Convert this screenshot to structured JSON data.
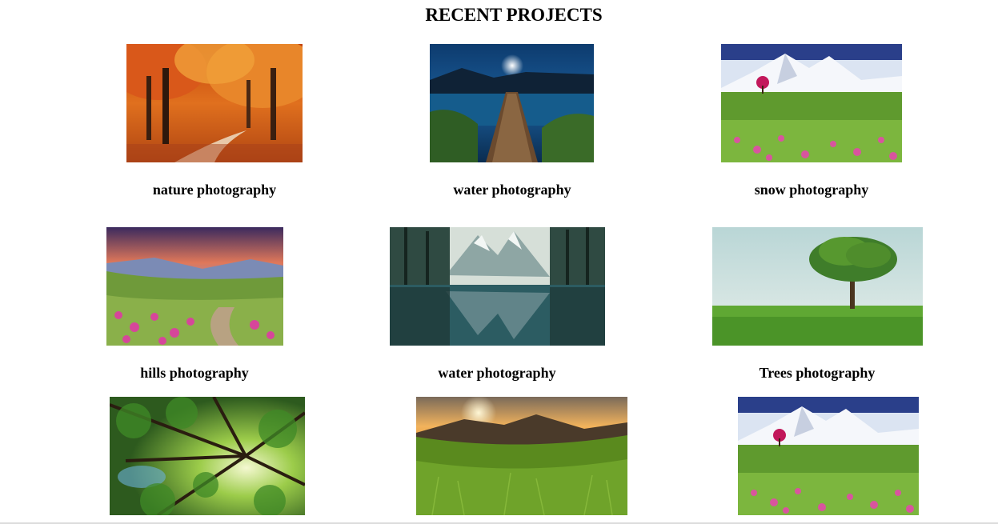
{
  "page": {
    "title": "RECENT PROJECTS"
  },
  "projects": [
    {
      "caption": "nature photography",
      "image": "autumn-forest-path-image"
    },
    {
      "caption": "water photography",
      "image": "lake-jetty-moon-image"
    },
    {
      "caption": "snow photography",
      "image": "snowy-mountain-meadow-image"
    },
    {
      "caption": "hills photography",
      "image": "hills-sunset-flowers-image"
    },
    {
      "caption": "water photography",
      "image": "mountain-lake-reflection-image"
    },
    {
      "caption": "Trees photography",
      "image": "lone-tree-field-image"
    },
    {
      "caption": "",
      "image": "forest-canopy-image"
    },
    {
      "caption": "",
      "image": "sunset-grassland-image"
    },
    {
      "caption": "",
      "image": "snowy-mountain-meadow-image"
    }
  ]
}
